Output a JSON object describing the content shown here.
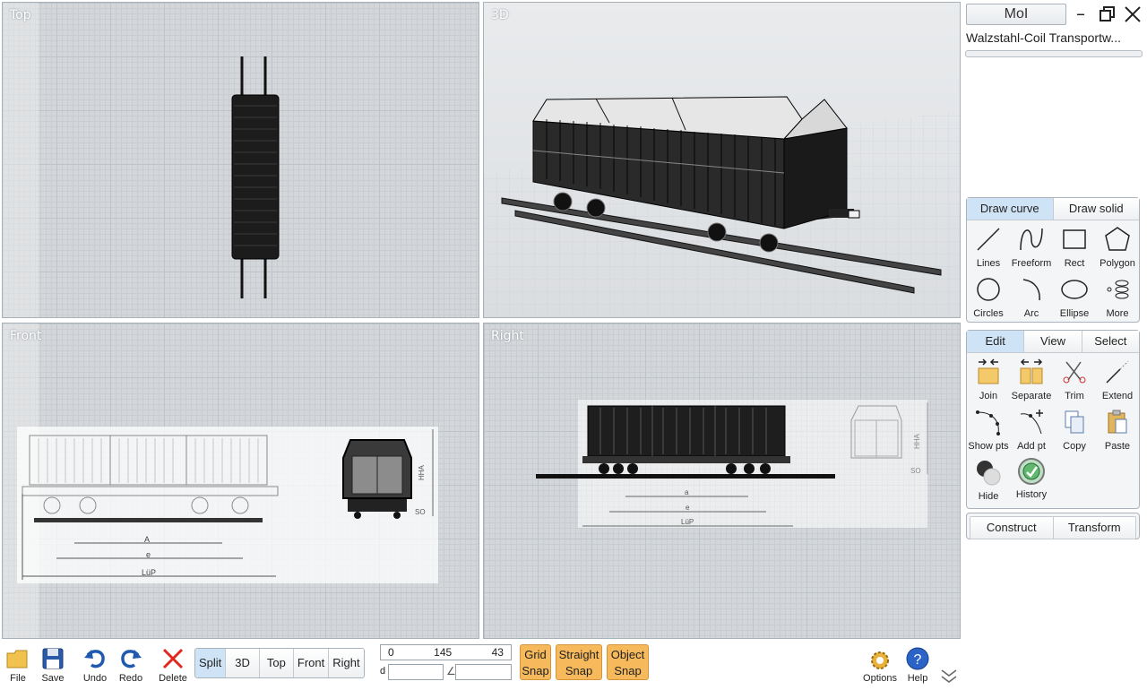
{
  "viewports": {
    "top": {
      "label": "Top"
    },
    "threed": {
      "label": "3D"
    },
    "front": {
      "label": "Front"
    },
    "right": {
      "label": "Right"
    }
  },
  "reference_drawing_labels": {
    "front": {
      "a": "A",
      "e": "e",
      "lup": "LüP",
      "ha": "HHA",
      "so": "SO"
    },
    "right": {
      "a": "a",
      "e": "e",
      "lup": "LüP",
      "ha": "HHA",
      "so": "SO"
    }
  },
  "app": {
    "name": "MoI",
    "file_title": "Walzstahl-Coil Transportw..."
  },
  "draw_panel": {
    "tabs": [
      {
        "label": "Draw curve",
        "active": true
      },
      {
        "label": "Draw solid",
        "active": false
      }
    ],
    "commands": [
      {
        "label": "Lines",
        "icon": "lines-icon"
      },
      {
        "label": "Freeform",
        "icon": "freeform-icon"
      },
      {
        "label": "Rect",
        "icon": "rect-icon"
      },
      {
        "label": "Polygon",
        "icon": "polygon-icon"
      },
      {
        "label": "Circles",
        "icon": "circle-icon"
      },
      {
        "label": "Arc",
        "icon": "arc-icon"
      },
      {
        "label": "Ellipse",
        "icon": "ellipse-icon"
      },
      {
        "label": "More",
        "icon": "spiral-icon"
      }
    ]
  },
  "edit_panel": {
    "tabs": [
      {
        "label": "Edit",
        "active": true
      },
      {
        "label": "View",
        "active": false
      },
      {
        "label": "Select",
        "active": false
      }
    ],
    "commands": [
      {
        "label": "Join",
        "icon": "join-icon"
      },
      {
        "label": "Separate",
        "icon": "separate-icon"
      },
      {
        "label": "Trim",
        "icon": "scissors-icon"
      },
      {
        "label": "Extend",
        "icon": "extend-icon"
      },
      {
        "label": "Show pts",
        "icon": "show-points-icon"
      },
      {
        "label": "Add pt",
        "icon": "add-point-icon"
      },
      {
        "label": "Copy",
        "icon": "copy-icon"
      },
      {
        "label": "Paste",
        "icon": "paste-icon"
      },
      {
        "label": "Hide",
        "icon": "hide-icon"
      },
      {
        "label": "History",
        "icon": "history-icon"
      }
    ]
  },
  "bottom_panel": {
    "tabs": [
      {
        "label": "Construct"
      },
      {
        "label": "Transform"
      }
    ]
  },
  "toolbar": {
    "file": "File",
    "save": "Save",
    "undo": "Undo",
    "redo": "Redo",
    "delete": "Delete",
    "views": [
      {
        "label": "Split",
        "active": true
      },
      {
        "label": "3D",
        "active": false
      },
      {
        "label": "Top",
        "active": false
      },
      {
        "label": "Front",
        "active": false
      },
      {
        "label": "Right",
        "active": false
      }
    ],
    "coords": {
      "x": "0",
      "y": "145",
      "z": "43"
    },
    "distance_label": "d",
    "snaps": {
      "grid": [
        "Grid",
        "Snap"
      ],
      "straight": [
        "Straight",
        "Snap"
      ],
      "object": [
        "Object",
        "Snap"
      ]
    },
    "options": "Options",
    "help": "Help"
  },
  "colors": {
    "accent_tab": "#cfe3f7",
    "snap_active": "#f6b95b"
  }
}
